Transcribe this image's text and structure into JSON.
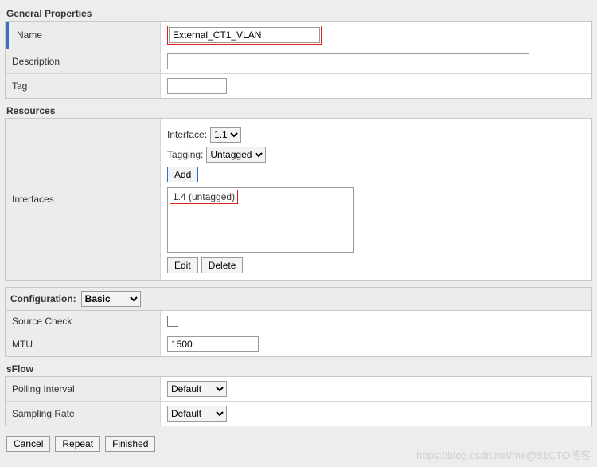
{
  "sections": {
    "general": {
      "title": "General Properties",
      "rows": {
        "name": {
          "label": "Name",
          "value": "External_CT1_VLAN"
        },
        "description": {
          "label": "Description",
          "value": ""
        },
        "tag": {
          "label": "Tag",
          "value": ""
        }
      }
    },
    "resources": {
      "title": "Resources",
      "interfaces": {
        "row_label": "Interfaces",
        "interface_label": "Interface:",
        "interface_value": "1.1",
        "tagging_label": "Tagging:",
        "tagging_value": "Untagged",
        "add_label": "Add",
        "list_items": [
          "1.4 (untagged)"
        ],
        "edit_label": "Edit",
        "delete_label": "Delete"
      }
    },
    "configuration": {
      "bar_label": "Configuration:",
      "bar_value": "Basic",
      "source_check": {
        "label": "Source Check",
        "checked": false
      },
      "mtu": {
        "label": "MTU",
        "value": "1500"
      }
    },
    "sflow": {
      "title": "sFlow",
      "polling": {
        "label": "Polling Interval",
        "value": "Default"
      },
      "sampling": {
        "label": "Sampling Rate",
        "value": "Default"
      }
    }
  },
  "footer": {
    "cancel": "Cancel",
    "repeat": "Repeat",
    "finished": "Finished"
  },
  "watermark": "https://blog.csdn.net/me@51CTO博客"
}
